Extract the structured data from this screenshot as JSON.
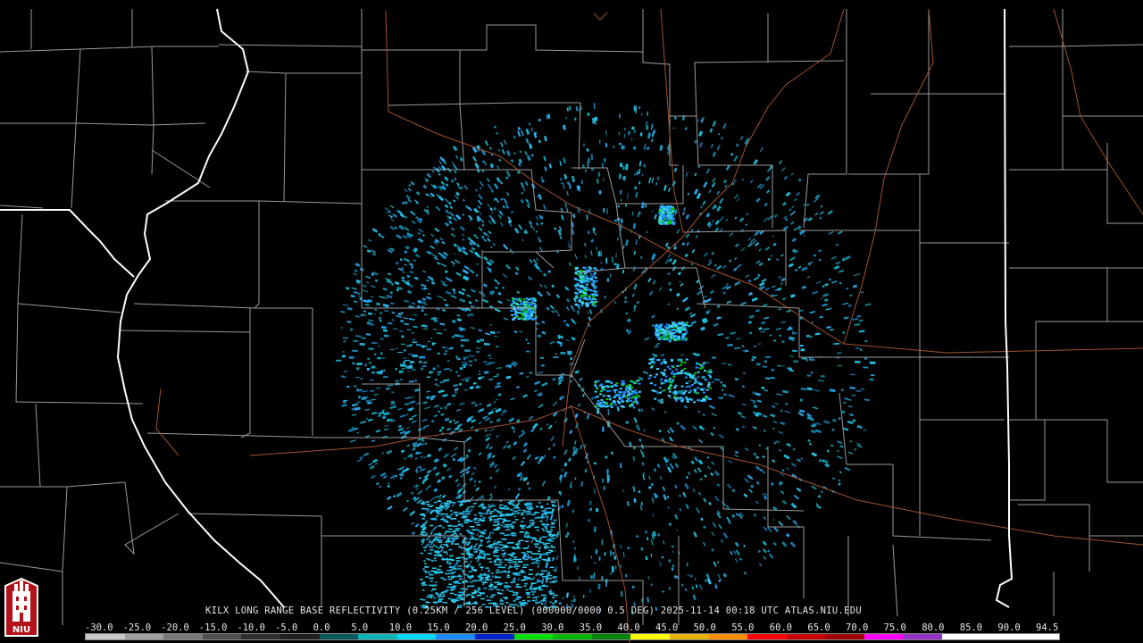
{
  "product": {
    "caption": "KILX LONG RANGE BASE REFLECTIVITY (0.25KM / 256 LEVEL) (000000/0000 0.5 DEG) 2025-11-14 00:18 UTC  ATLAS.NIU.EDU",
    "station": "KILX",
    "timestamp": "2025-11-14 00:18 UTC",
    "source": "ATLAS.NIU.EDU"
  },
  "scale": {
    "labels": [
      "-30.0",
      "-25.0",
      "-20.0",
      "-15.0",
      "-10.0",
      "-5.0",
      "0.0",
      "5.0",
      "10.0",
      "15.0",
      "20.0",
      "25.0",
      "30.0",
      "35.0",
      "40.0",
      "45.0",
      "50.0",
      "55.0",
      "60.0",
      "65.0",
      "70.0",
      "75.0",
      "80.0",
      "85.0",
      "90.0",
      "94.5"
    ],
    "colors": [
      "#c8c8c8",
      "#a0a0a0",
      "#787878",
      "#505050",
      "#303030",
      "#202020",
      "#0a5a5a",
      "#08b4b4",
      "#00d8ff",
      "#1a8cff",
      "#0020c8",
      "#00e000",
      "#00b400",
      "#008400",
      "#ffff00",
      "#e6b400",
      "#ff8c00",
      "#ff0000",
      "#c80000",
      "#a00000",
      "#ff00ff",
      "#9632c8",
      "#ffffff",
      "#ffffff",
      "#ffffff"
    ]
  },
  "logo": {
    "text": "NIU",
    "icon": "niu-seal-icon"
  },
  "colors": {
    "background": "#000000",
    "county_lines": "#9a9a9a",
    "state_lines": "#ffffff",
    "highways": "#a0522d",
    "echo_main": "#1ec8e6",
    "echo_light": "#32b4ff",
    "echo_strong": "#1a8cff",
    "echo_green": "#00c800"
  }
}
